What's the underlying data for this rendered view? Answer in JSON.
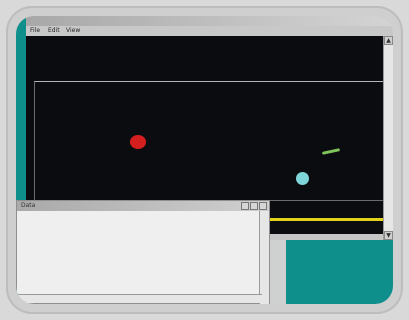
{
  "main_window": {
    "title": "",
    "menu": [
      "File",
      "Edit",
      "View"
    ]
  },
  "table_window": {
    "title": "Data",
    "headers": [
      "",
      "",
      "",
      "",
      "",
      "",
      "",
      "",
      "",
      "",
      "",
      ""
    ],
    "rows": [
      [
        "",
        "",
        "",
        "",
        "",
        "",
        "",
        "",
        "",
        "",
        "",
        ""
      ],
      [
        "",
        "",
        "",
        "",
        "",
        "",
        "",
        "",
        "",
        "",
        "",
        ""
      ],
      [
        "",
        "",
        "",
        "",
        "",
        "",
        "",
        "",
        "",
        "",
        "",
        ""
      ],
      [
        "",
        "",
        "",
        "",
        "",
        "",
        "",
        "",
        "",
        "",
        "",
        ""
      ],
      [
        "",
        "",
        "",
        "",
        "",
        "",
        "",
        "",
        "",
        "",
        "",
        ""
      ],
      [
        "",
        "",
        "",
        "",
        "",
        "",
        "",
        "",
        "",
        "",
        "",
        ""
      ],
      [
        "",
        "",
        "",
        "",
        "",
        "",
        "",
        "",
        "",
        "",
        "",
        ""
      ],
      [
        "",
        "",
        "",
        "",
        "",
        "",
        "",
        "",
        "",
        "",
        "",
        ""
      ],
      [
        "",
        "",
        "",
        "",
        "",
        "",
        "",
        "",
        "",
        "",
        "",
        ""
      ]
    ]
  },
  "colors": {
    "desktop": "#0e8f8b",
    "canvas_bg": "#0b0c0f",
    "red_object": "#d51f1f",
    "cyan_object": "#7fd6da",
    "green_trace": "#7ec45a",
    "yellow_trace": "#e2d21b"
  }
}
